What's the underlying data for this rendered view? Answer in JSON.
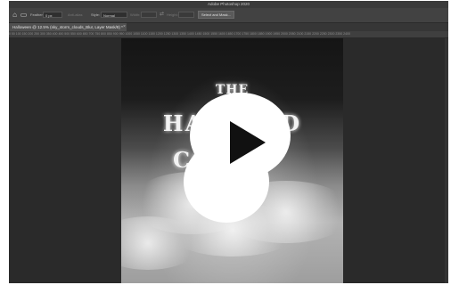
{
  "app": {
    "window_title": "Adobe Photoshop 2020"
  },
  "options_bar": {
    "feather_label": "Feather:",
    "feather_value": "0 px",
    "antialias_label": "Anti-alias",
    "style_label": "Style:",
    "style_value": "Normal",
    "width_label": "Width:",
    "height_label": "Height:",
    "select_mask_button": "Select and Mask..."
  },
  "document": {
    "tab_label": "Halloween @ 12.5% (sky_storm_clouds_Blur, Layer Mask/8) *",
    "ruler_text": "0  50  100  150  200  250  300  350  400  450  500  550  600  650  700  750  800  850  900  950  1000  1050  1100  1150  1200  1250  1300  1350  1400  1450  1500  1550  1600  1650  1700  1750  1800  1850  1900  1950  2000  2050  2100  2150  2200  2250  2300  2350  2400"
  },
  "poster": {
    "line1": "THE",
    "line2": "HAUNTED",
    "line3": "CO"
  },
  "overlay": {
    "icon": "play-icon"
  },
  "colors": {
    "workspace": "#2a2a2a",
    "chrome": "#424242",
    "overlay": "#ffffff",
    "play_glyph": "#111111"
  }
}
